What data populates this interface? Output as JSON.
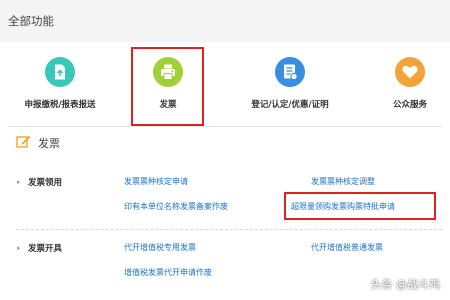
{
  "header": {
    "title": "全部功能"
  },
  "functions": [
    {
      "label": "申报缴税/报表报送",
      "icon": "document-upload-icon",
      "color": "#39c8b8"
    },
    {
      "label": "发票",
      "icon": "printer-icon",
      "color": "#9fd03a",
      "selected": true
    },
    {
      "label": "登记/认定/优惠/证明",
      "icon": "registration-card-icon",
      "color": "#3a8de0"
    },
    {
      "label": "公众服务",
      "icon": "heart-icon",
      "color": "#f2a43a"
    }
  ],
  "section": {
    "title": "发票",
    "icon": "pencil-icon"
  },
  "categories": [
    {
      "label": "发票领用",
      "links": [
        "发票票种核定申请",
        "发票票种核定调整",
        "印有本单位名称发票备案作废",
        "超限量领购发票购票特批申请"
      ]
    },
    {
      "label": "发票开具",
      "links": [
        "代开增值税专用发票",
        "代开增值税普通发票",
        "增值税发票代开申请作废"
      ]
    }
  ],
  "highlighted_link": "超限量领购发票购票特批申请",
  "colors": {
    "link": "#1d73c6",
    "highlight": "#dd2222",
    "header_bg": "#f4f4f4"
  },
  "watermark": "头条 @战斗鸡"
}
